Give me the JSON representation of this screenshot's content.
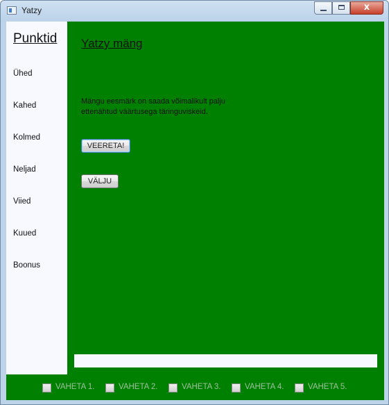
{
  "window": {
    "title": "Yatzy",
    "controls": {
      "minimize": "minimize",
      "maximize": "maximize",
      "close": "x"
    }
  },
  "sidebar": {
    "title": "Punktid",
    "items": [
      "Ühed",
      "Kahed",
      "Kolmed",
      "Neljad",
      "Viied",
      "Kuued",
      "Boonus"
    ]
  },
  "main": {
    "title": "Yatzy mäng",
    "description_line1": "Mängu eesmärk on saada võimalikult palju",
    "description_line2": "ettenähtud väärtusega täringuviskeid.",
    "roll_button": "VEERETA!",
    "exit_button": "VÄLJU",
    "status_text": ""
  },
  "swaps": [
    "VAHETA 1.",
    "VAHETA 2.",
    "VAHETA 3.",
    "VAHETA 4.",
    "VAHETA 5."
  ],
  "colors": {
    "background": "#008000",
    "panel": "#f7f9ff",
    "disabled_text": "#9fbf9f"
  }
}
